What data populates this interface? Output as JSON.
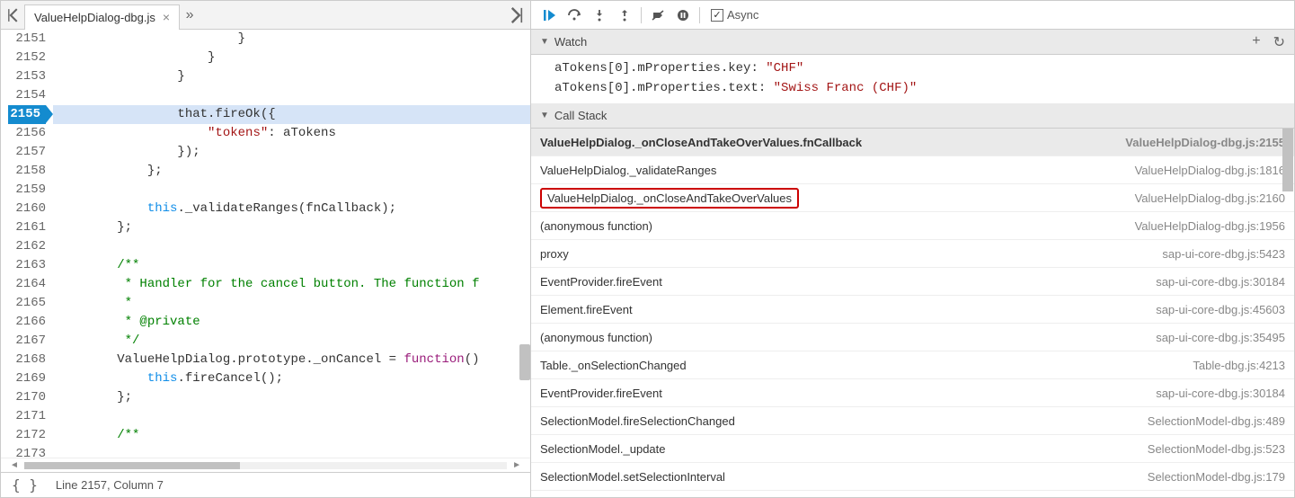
{
  "tab": {
    "name": "ValueHelpDialog-dbg.js"
  },
  "lines": [
    "2151",
    "2152",
    "2153",
    "2154",
    "2155",
    "2156",
    "2157",
    "2158",
    "2159",
    "2160",
    "2161",
    "2162",
    "2163",
    "2164",
    "2165",
    "2166",
    "2167",
    "2168",
    "2169",
    "2170",
    "2171",
    "2172",
    "2173"
  ],
  "current_line": "2155",
  "status": "Line 2157, Column 7",
  "toolbar": {
    "async_label": "Async"
  },
  "watch": {
    "title": "Watch",
    "items": [
      {
        "expr": "aTokens[0].mProperties.key",
        "value": "\"CHF\""
      },
      {
        "expr": "aTokens[0].mProperties.text",
        "value": "\"Swiss Franc (CHF)\""
      }
    ]
  },
  "callstack": {
    "title": "Call Stack",
    "rows": [
      {
        "name": "ValueHelpDialog._onCloseAndTakeOverValues.fnCallback",
        "loc": "ValueHelpDialog-dbg.js:2155",
        "selected": true,
        "hl": false
      },
      {
        "name": "ValueHelpDialog._validateRanges",
        "loc": "ValueHelpDialog-dbg.js:1816",
        "selected": false,
        "hl": false
      },
      {
        "name": "ValueHelpDialog._onCloseAndTakeOverValues",
        "loc": "ValueHelpDialog-dbg.js:2160",
        "selected": false,
        "hl": true
      },
      {
        "name": "(anonymous function)",
        "loc": "ValueHelpDialog-dbg.js:1956",
        "selected": false,
        "hl": false
      },
      {
        "name": "proxy",
        "loc": "sap-ui-core-dbg.js:5423",
        "selected": false,
        "hl": false
      },
      {
        "name": "EventProvider.fireEvent",
        "loc": "sap-ui-core-dbg.js:30184",
        "selected": false,
        "hl": false
      },
      {
        "name": "Element.fireEvent",
        "loc": "sap-ui-core-dbg.js:45603",
        "selected": false,
        "hl": false
      },
      {
        "name": "(anonymous function)",
        "loc": "sap-ui-core-dbg.js:35495",
        "selected": false,
        "hl": false
      },
      {
        "name": "Table._onSelectionChanged",
        "loc": "Table-dbg.js:4213",
        "selected": false,
        "hl": false
      },
      {
        "name": "EventProvider.fireEvent",
        "loc": "sap-ui-core-dbg.js:30184",
        "selected": false,
        "hl": false
      },
      {
        "name": "SelectionModel.fireSelectionChanged",
        "loc": "SelectionModel-dbg.js:489",
        "selected": false,
        "hl": false
      },
      {
        "name": "SelectionModel._update",
        "loc": "SelectionModel-dbg.js:523",
        "selected": false,
        "hl": false
      },
      {
        "name": "SelectionModel.setSelectionInterval",
        "loc": "SelectionModel-dbg.js:179",
        "selected": false,
        "hl": false
      }
    ]
  },
  "code": {
    "l2151": "                        }",
    "l2152": "                    }",
    "l2153": "                }",
    "l2154": "",
    "l2156a": "                    ",
    "l2156b": "\"tokens\"",
    "l2156c": ": aTokens",
    "l2157": "                });",
    "l2158": "            };",
    "l2159": "",
    "l2160a": "            ",
    "l2160b": "this",
    "l2160c": "._validateRanges(fnCallback);",
    "l2161": "        };",
    "l2162": "",
    "l2163": "        /**",
    "l2164": "         * Handler for the cancel button. The function f",
    "l2165": "         *",
    "l2166": "         * @private",
    "l2167": "         */",
    "l2168a": "        ValueHelpDialog.prototype._onCancel = ",
    "l2168b": "function",
    "l2168c": "()",
    "l2169a": "            ",
    "l2169b": "this",
    "l2169c": ".fireCancel();",
    "l2170": "        };",
    "l2171": "",
    "l2172": "        /**",
    "l2155a": "                that.fireOk({"
  }
}
